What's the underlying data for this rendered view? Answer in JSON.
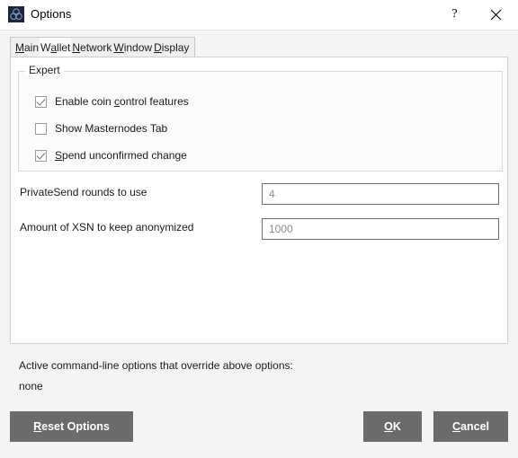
{
  "window": {
    "title": "Options",
    "icon": "app-logo-icon",
    "help_label": "?",
    "close_label": "✕"
  },
  "tabs": [
    {
      "id": "main",
      "label": "Main",
      "mnemonic": "M",
      "selected": false
    },
    {
      "id": "wallet",
      "label": "Wallet",
      "mnemonic": "a",
      "selected": true
    },
    {
      "id": "network",
      "label": "Network",
      "mnemonic": "N",
      "selected": false
    },
    {
      "id": "window",
      "label": "Window",
      "mnemonic": "W",
      "selected": false
    },
    {
      "id": "display",
      "label": "Display",
      "mnemonic": "D",
      "selected": false
    }
  ],
  "expert_group": {
    "title": "Expert",
    "checkboxes": [
      {
        "id": "coin-control",
        "label_before": "Enable coin ",
        "mnemonic": "c",
        "label_after": "ontrol features",
        "checked": true
      },
      {
        "id": "masternodes",
        "label_before": "Show Masternodes Tab",
        "mnemonic": "",
        "label_after": "",
        "checked": false
      },
      {
        "id": "spend-unconf",
        "label_before": "",
        "mnemonic": "S",
        "label_after": "pend unconfirmed chan",
        "mnemonic2": "g",
        "label_after2": "e",
        "checked": true
      }
    ]
  },
  "fields": [
    {
      "id": "privatesend-rounds",
      "label": "PrivateSend rounds to use",
      "value": "4",
      "placeholder": "4"
    },
    {
      "id": "keep-anonymized",
      "label": "Amount of XSN to keep anonymized",
      "value": "1000",
      "placeholder": "1000"
    }
  ],
  "commandline": {
    "title": "Active command-line options that override above options:",
    "value": "none"
  },
  "buttons": {
    "reset": {
      "label_before": "",
      "mnemonic": "R",
      "label_after": "eset Options"
    },
    "ok": {
      "label_before": "",
      "mnemonic": "O",
      "label_after": "K"
    },
    "cancel": {
      "label_before": "",
      "mnemonic": "C",
      "label_after": "ancel"
    }
  },
  "colors": {
    "dialog_bg": "#f5f4f4",
    "panel_bg": "#ffffff",
    "titlebar_bg": "#ffffff",
    "button_bg": "#6b6b6b",
    "button_fg": "#ffffff",
    "icon_bg": "#1b2440",
    "input_border": "#6b6b6b",
    "input_text": "#8d8d8d",
    "tab_bg": "#f0efef",
    "tab_selected_bg": "#fbfbfb"
  }
}
